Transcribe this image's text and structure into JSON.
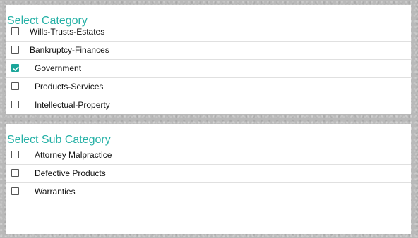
{
  "category": {
    "title": "Select Category",
    "items": [
      {
        "label": "Wills-Trusts-Estates",
        "checked": false
      },
      {
        "label": "Bankruptcy-Finances",
        "checked": false
      },
      {
        "label": "Government",
        "checked": true
      },
      {
        "label": "Products-Services",
        "checked": false
      },
      {
        "label": "Intellectual-Property",
        "checked": false
      }
    ]
  },
  "sub_category": {
    "title": "Select Sub Category",
    "items": [
      {
        "label": "Attorney Malpractice",
        "checked": false
      },
      {
        "label": "Defective Products",
        "checked": false
      },
      {
        "label": "Warranties",
        "checked": false
      }
    ]
  },
  "colors": {
    "accent": "#26b1a6",
    "check": "#1ba69a"
  }
}
